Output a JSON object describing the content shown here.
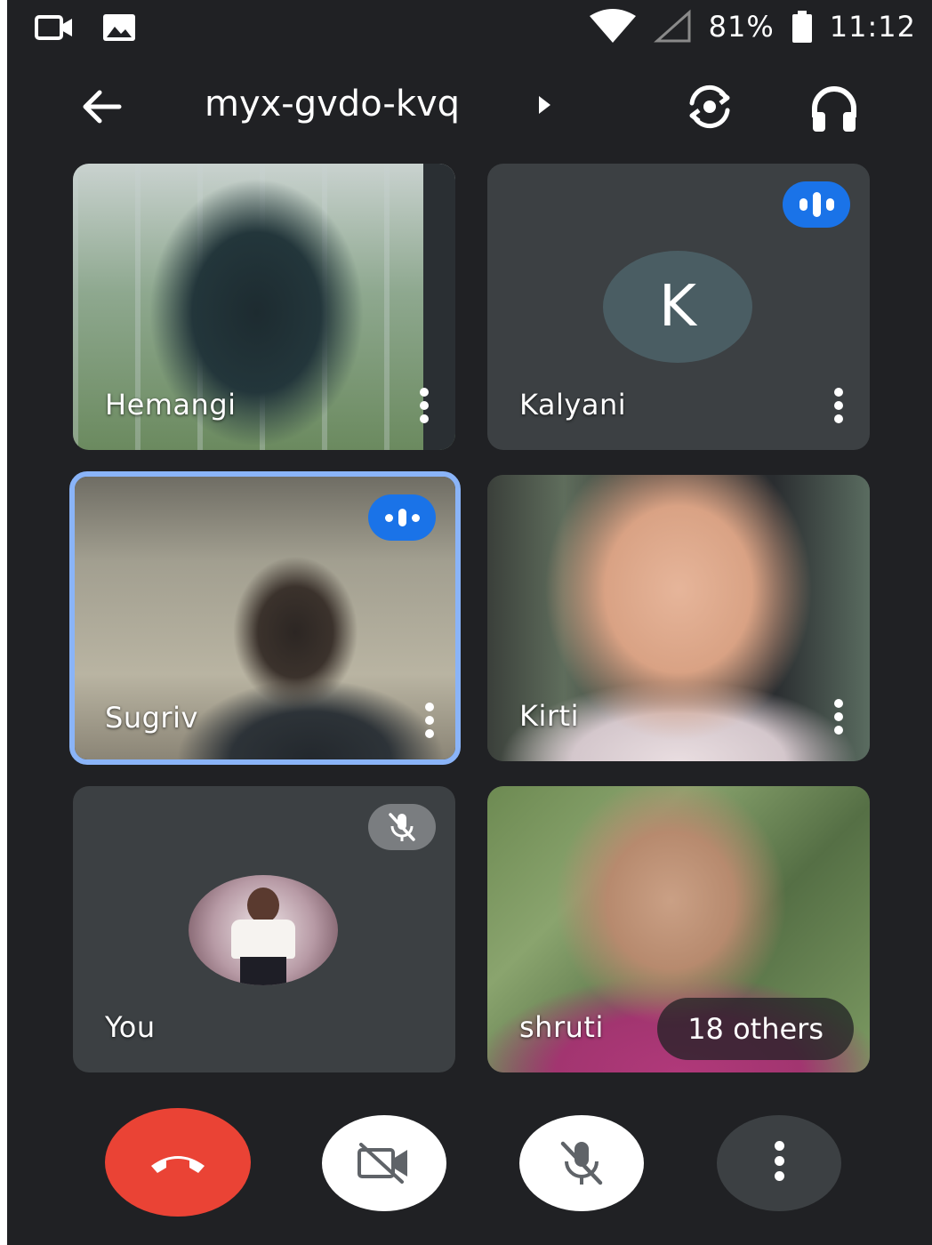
{
  "status_bar": {
    "battery": "81%",
    "time": "11:12",
    "left_icons": [
      "video-camera-icon",
      "image-icon"
    ],
    "right_icons": [
      "wifi-icon",
      "cellular-signal-icon",
      "battery-icon"
    ]
  },
  "app_bar": {
    "meeting_code": "myx-gvdo-kvq",
    "icons": [
      "back-arrow-icon",
      "caret-right-icon",
      "switch-camera-icon",
      "headphones-icon"
    ]
  },
  "participants": [
    {
      "name": "Hemangi",
      "kind": "video"
    },
    {
      "name": "Kalyani",
      "kind": "initial",
      "initial": "K",
      "speaking": true
    },
    {
      "name": "Sugriv",
      "kind": "video",
      "speaking": true,
      "highlighted": true
    },
    {
      "name": "Kirti",
      "kind": "video"
    },
    {
      "name": "You",
      "kind": "avatar",
      "muted": true
    },
    {
      "name": "shruti",
      "kind": "video"
    }
  ],
  "others_label": "18 others",
  "controls": [
    "end-call-button",
    "camera-off-button",
    "mic-off-button",
    "more-options-button"
  ],
  "colors": {
    "background": "#202124",
    "tile": "#3c4043",
    "speaking": "#1a73e8",
    "end_call": "#ea4335",
    "highlight": "#8ab4f8"
  }
}
